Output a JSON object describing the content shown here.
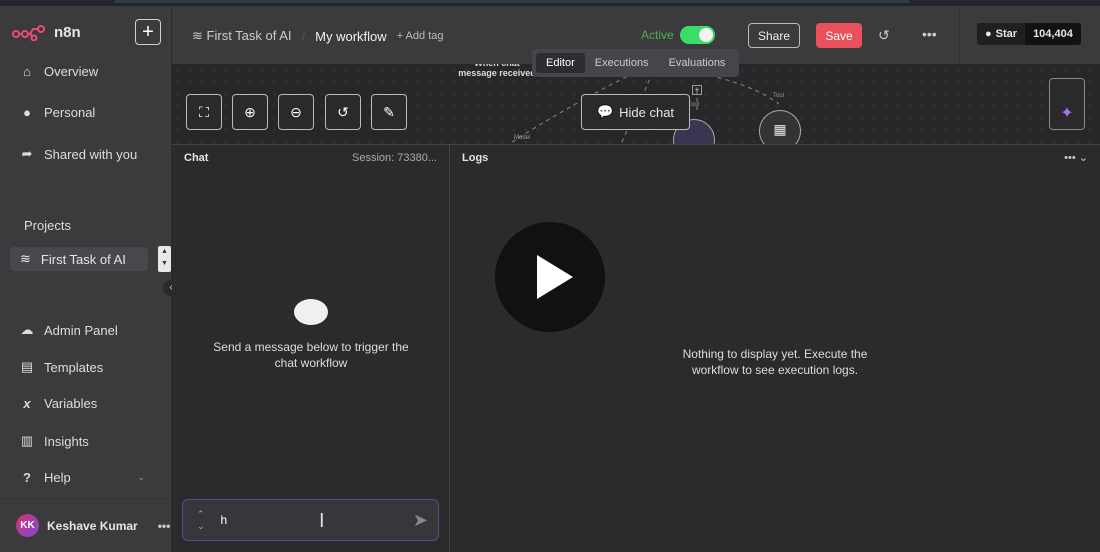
{
  "app": {
    "name": "n8n"
  },
  "sidebar": {
    "items": [
      {
        "label": "Overview",
        "icon": "home-icon"
      },
      {
        "label": "Personal",
        "icon": "user-icon"
      },
      {
        "label": "Shared with you",
        "icon": "share-icon"
      }
    ],
    "projects_label": "Projects",
    "project": "First Task of AI",
    "bottom": [
      {
        "label": "Admin Panel"
      },
      {
        "label": "Templates"
      },
      {
        "label": "Variables"
      },
      {
        "label": "Insights"
      },
      {
        "label": "Help"
      }
    ],
    "user": {
      "initials": "KK",
      "name": "Keshave Kumar"
    }
  },
  "header": {
    "project": "First Task of AI",
    "workflow": "My workflow",
    "add_tag": "+ Add tag",
    "active_label": "Active",
    "active": true,
    "share": "Share",
    "save": "Save",
    "github_star": "Star",
    "github_count": "104,404"
  },
  "canvas": {
    "tabs": [
      "Editor",
      "Executions",
      "Evaluations"
    ],
    "active_tab": "Editor",
    "trigger_label": "When chat message received",
    "hide_chat": "Hide chat",
    "labels": {
      "model": "Model",
      "tool1": "Tool",
      "tool2": "Tool"
    }
  },
  "chat": {
    "title": "Chat",
    "session": "Session: 73380...",
    "empty": "Send a message below to trigger the chat workflow",
    "input_value": "h"
  },
  "logs": {
    "title": "Logs",
    "empty": "Nothing to display yet. Execute the workflow to see execution logs."
  },
  "colors": {
    "accent": "#e8505b",
    "active": "#3ddc68"
  }
}
